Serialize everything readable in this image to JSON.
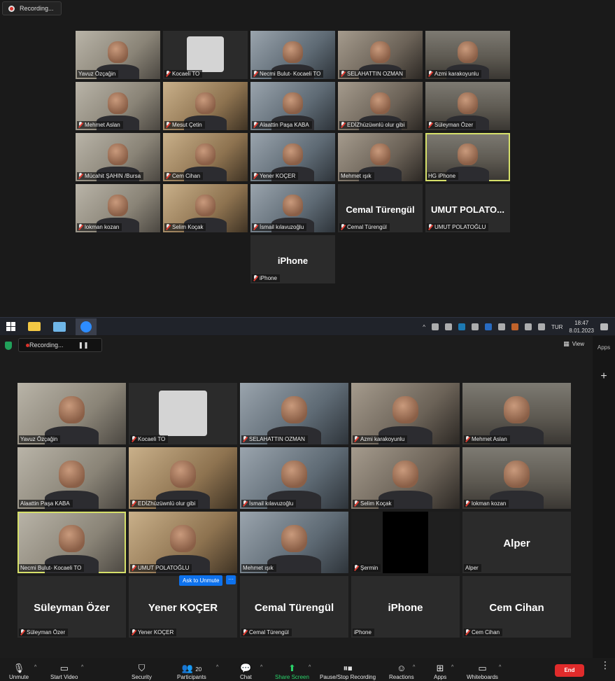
{
  "top_window": {
    "recording_label": "Recording...",
    "tiles": [
      {
        "name": "Yavuz Özçağin",
        "type": "photo",
        "muted": false
      },
      {
        "name": "Kocaeli TO",
        "type": "logo",
        "muted": true
      },
      {
        "name": "Necmi Bulut- Kocaeli TO",
        "type": "photo",
        "muted": true
      },
      {
        "name": "SELAHATTIN OZMAN",
        "type": "photo",
        "muted": true
      },
      {
        "name": "Azmi karakoyunlu",
        "type": "photo",
        "muted": true
      },
      {
        "name": "Mehmet Aslan",
        "type": "photo",
        "muted": true
      },
      {
        "name": "Mesut Çetin",
        "type": "photo",
        "muted": true
      },
      {
        "name": "Alaattin Paşa KABA",
        "type": "photo",
        "muted": true
      },
      {
        "name": "EDİZhüzüwnlü olur gibi",
        "type": "photo",
        "muted": true
      },
      {
        "name": "Süleyman Özer",
        "type": "photo",
        "muted": true
      },
      {
        "name": "Mücahit ŞAHIN /Bursa",
        "type": "photo",
        "muted": true
      },
      {
        "name": "Cem Cihan",
        "type": "photo",
        "muted": true
      },
      {
        "name": "Yener KOÇER",
        "type": "photo",
        "muted": true
      },
      {
        "name": "Mehmet ışık",
        "type": "photo",
        "muted": false
      },
      {
        "name": "HG iPhone",
        "type": "photo",
        "muted": false,
        "speaker": true
      },
      {
        "name": "lokman kozan",
        "type": "photo",
        "muted": true
      },
      {
        "name": "Selim Koçak",
        "type": "photo",
        "muted": true
      },
      {
        "name": "İsmail kılavuzoğlu",
        "type": "photo",
        "muted": true
      },
      {
        "name": "Cemal Türengül",
        "big": "Cemal Türengül",
        "type": "name",
        "muted": true
      },
      {
        "name": "UMUT POLATOĞLU",
        "big": "UMUT POLATO...",
        "type": "name",
        "muted": true
      },
      {
        "name": "iPhone",
        "big": "iPhone",
        "type": "name",
        "muted": true
      }
    ]
  },
  "taskbar": {
    "language": "TUR",
    "time": "18:47",
    "date": "8.01.2023",
    "notifications": "1"
  },
  "zoom": {
    "recording_label": "Recording...",
    "view_label": "View",
    "apps_label": "Apps",
    "plus_label": "+",
    "ask_to_unmute": "Ask to Unmute",
    "more_dots": "···",
    "tiles": [
      {
        "name": "Yavuz Özçağin",
        "type": "photo",
        "muted": false
      },
      {
        "name": "Kocaeli TO",
        "type": "logo",
        "muted": true
      },
      {
        "name": "SELAHATTIN OZMAN",
        "type": "photo",
        "muted": true
      },
      {
        "name": "Azmi karakoyunlu",
        "type": "photo",
        "muted": true
      },
      {
        "name": "Mehmet Aslan",
        "type": "photo",
        "muted": true
      },
      {
        "name": "Alaattin Paşa KABA",
        "type": "photo",
        "muted": false
      },
      {
        "name": "EDİZhüzüwnlü olur gibi",
        "type": "photo",
        "muted": true
      },
      {
        "name": "İsmail kılavuzoğlu",
        "type": "photo",
        "muted": true
      },
      {
        "name": "Selim Koçak",
        "type": "photo",
        "muted": true
      },
      {
        "name": "lokman kozan",
        "type": "photo",
        "muted": true
      },
      {
        "name": "Necmi Bulut- Kocaeli TO",
        "type": "photo",
        "muted": false,
        "speaker": true
      },
      {
        "name": "UMUT POLATOĞLU",
        "type": "photo",
        "muted": true
      },
      {
        "name": "Mehmet ışık",
        "type": "photo",
        "muted": false
      },
      {
        "name": "Şermin",
        "type": "black",
        "muted": true
      },
      {
        "name": "Alper",
        "big": "Alper",
        "type": "name",
        "muted": false
      },
      {
        "name": "Süleyman Özer",
        "big": "Süleyman Özer",
        "type": "name",
        "muted": true
      },
      {
        "name": "Yener KOÇER",
        "big": "Yener KOÇER",
        "type": "name",
        "muted": true
      },
      {
        "name": "Cemal Türengül",
        "big": "Cemal Türengül",
        "type": "name",
        "muted": true
      },
      {
        "name": "iPhone",
        "big": "iPhone",
        "type": "name",
        "muted": false
      },
      {
        "name": "Cem Cihan",
        "big": "Cem Cihan",
        "type": "name",
        "muted": true
      }
    ],
    "toolbar": {
      "unmute": "Unmute",
      "start_video": "Start Video",
      "security": "Security",
      "participants": "Participants",
      "participants_count": "20",
      "chat": "Chat",
      "share_screen": "Share Screen",
      "pause_stop_recording": "Pause/Stop Recording",
      "reactions": "Reactions",
      "apps": "Apps",
      "whiteboards": "Whiteboards",
      "end": "End",
      "more": "⋮"
    }
  }
}
